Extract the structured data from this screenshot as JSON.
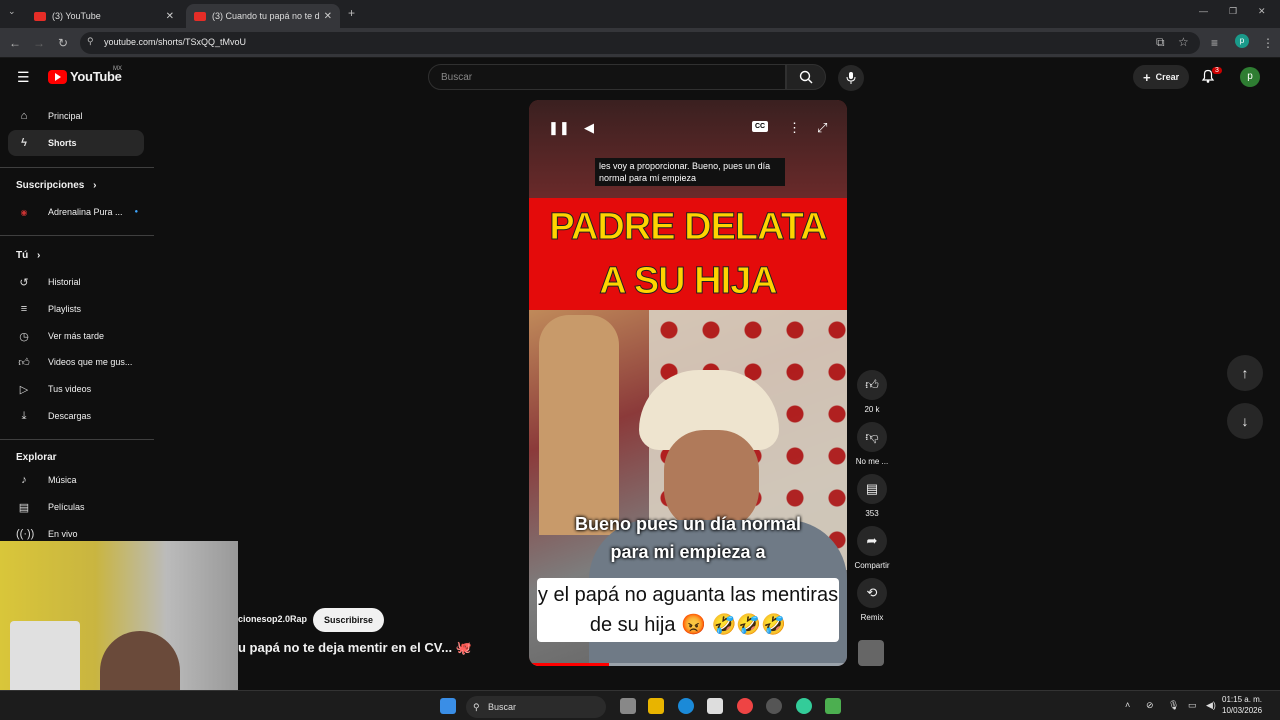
{
  "browser": {
    "tabs": [
      {
        "label": "(3) YouTube"
      },
      {
        "label": "(3) Cuando tu papá no te d"
      }
    ],
    "url": "youtube.com/shorts/TSxQQ_tMvoU"
  },
  "header": {
    "logo_text": "YouTube",
    "logo_region": "MX",
    "search_placeholder": "Buscar",
    "create_label": "Crear",
    "notif_count": "3",
    "avatar_letter": "p"
  },
  "sidebar": {
    "items": [
      {
        "label": "Principal",
        "icon": "home-icon"
      },
      {
        "label": "Shorts",
        "icon": "shorts-icon"
      }
    ],
    "subs_heading": "Suscripciones",
    "subs": [
      {
        "label": "Adrenalina Pura ..."
      }
    ],
    "you_heading": "Tú",
    "you_items": [
      {
        "label": "Historial"
      },
      {
        "label": "Playlists"
      },
      {
        "label": "Ver más tarde"
      },
      {
        "label": "Videos que me gus..."
      },
      {
        "label": "Tus videos"
      },
      {
        "label": "Descargas"
      }
    ],
    "explore_heading": "Explorar",
    "explore_items": [
      {
        "label": "Música"
      },
      {
        "label": "Películas"
      },
      {
        "label": "En vivo"
      }
    ]
  },
  "video": {
    "caption_top": "les voy a proporcionar. Bueno, pues un día normal para mí empieza",
    "title_line1": "PADRE DELATA",
    "title_line2": "A SU HIJA",
    "subtitle_a": "Bueno pues un día normal para mi empieza a",
    "subtitle_b": "y el papá no aguanta las mentiras de su hija 😡 🤣🤣🤣",
    "progress": 0.25,
    "channel": "cionesop2.0Rap",
    "subscribe_label": "Suscribirse",
    "title": "u papá no te deja mentir en el CV... 🐙"
  },
  "actions": {
    "likes": "20 k",
    "dislike_label": "No me ...",
    "comments": "353",
    "share_label": "Compartir",
    "remix_label": "Remix"
  },
  "taskbar": {
    "search_label": "Buscar",
    "time": "01:15 a. m.",
    "date": "10/03/2026"
  }
}
